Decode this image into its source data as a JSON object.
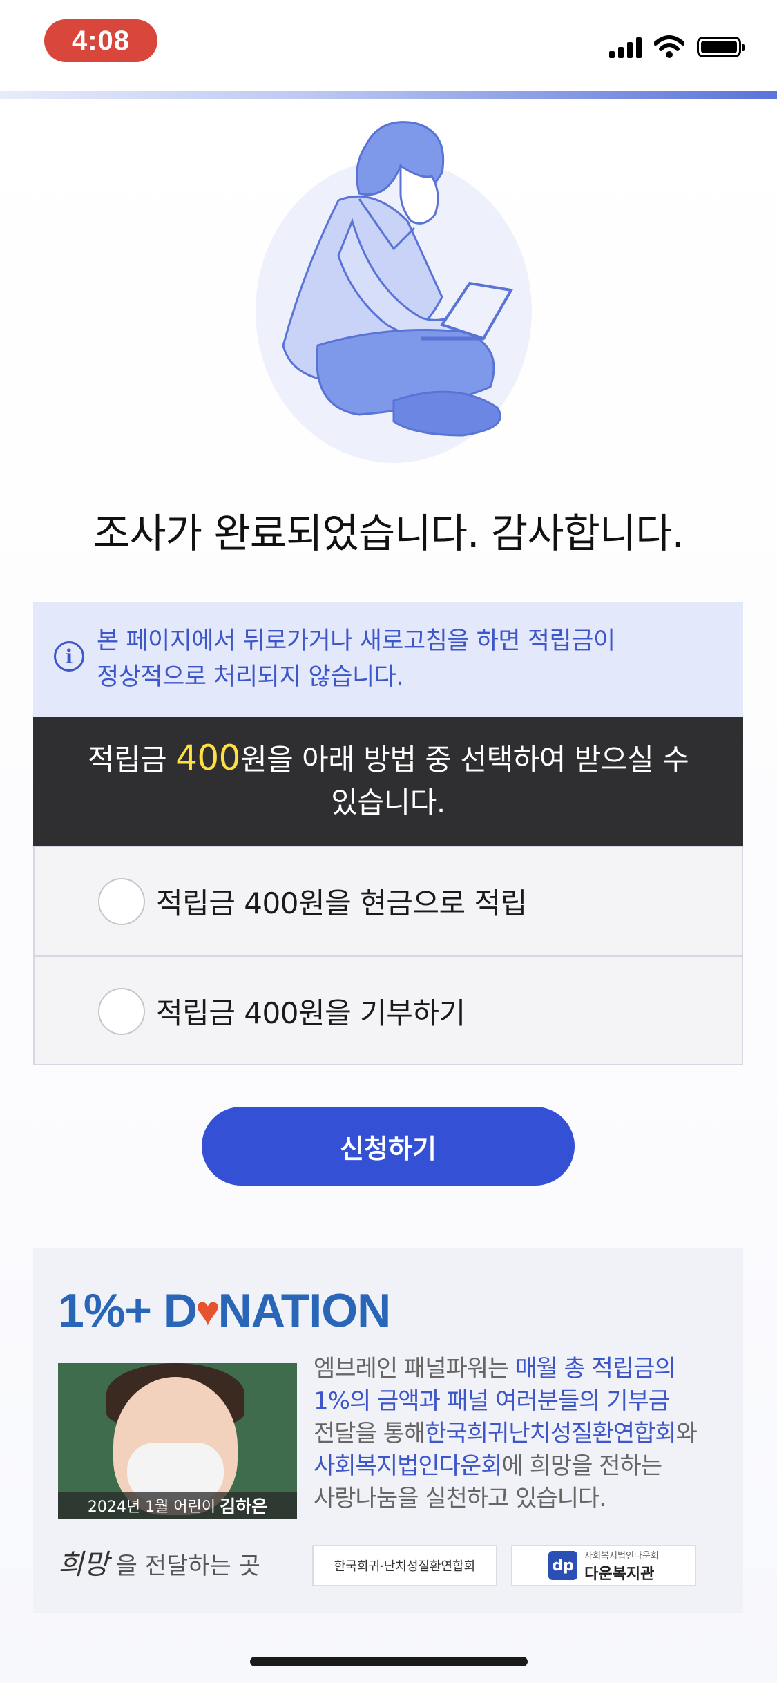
{
  "status_bar": {
    "time": "4:08",
    "icons": [
      "signal-icon",
      "wifi-icon",
      "battery-icon"
    ]
  },
  "colors": {
    "primary": "#3451d6",
    "notice_bg": "#e3e8fb",
    "dark_box": "#2f2f31",
    "amount_highlight": "#ffe040",
    "time_pill": "#d9463c"
  },
  "title": "조사가 완료되었습니다. 감사합니다.",
  "notice": {
    "line1": "본 페이지에서 뒤로가거나 새로고침을 하면 적립금이",
    "line2": "정상적으로 처리되지 않습니다."
  },
  "reward": {
    "prefix": "적립금 ",
    "amount": "400",
    "suffix_line1": "원을 아래 방법 중 선택하여 받으실 수",
    "suffix_line2": "있습니다."
  },
  "options": [
    {
      "label": "적립금 400원을 현금으로 적립",
      "selected": false
    },
    {
      "label": "적립금 400원을 기부하기",
      "selected": false
    }
  ],
  "submit_label": "신청하기",
  "donation": {
    "logo_left": "1%+ D",
    "logo_right": "NATION",
    "photo_caption_prefix": "2024년 1월 어린이",
    "photo_caption_name": "김하은",
    "text_1": "엠브레인 패널파워는 ",
    "text_2": "매월 총 적립금의",
    "text_3": "1%의 금액과 패널 여러분들의 기부금",
    "text_4": "전달을 통해",
    "text_5": "한국희귀난치성질환연합회",
    "text_6": "와",
    "text_7": "사회복지법인다운회",
    "text_8": "에 희망을 전하는",
    "text_9": "사랑나눔을 실천하고 있습니다.",
    "hope_script": "희망",
    "hope_text": "을 전달하는 곳",
    "partner1_text": "한국희귀·난치성질환연합회",
    "partner2_sub": "사회복지법인다운회",
    "partner2_name": "다운복지관",
    "partner2_logo": "dp"
  }
}
